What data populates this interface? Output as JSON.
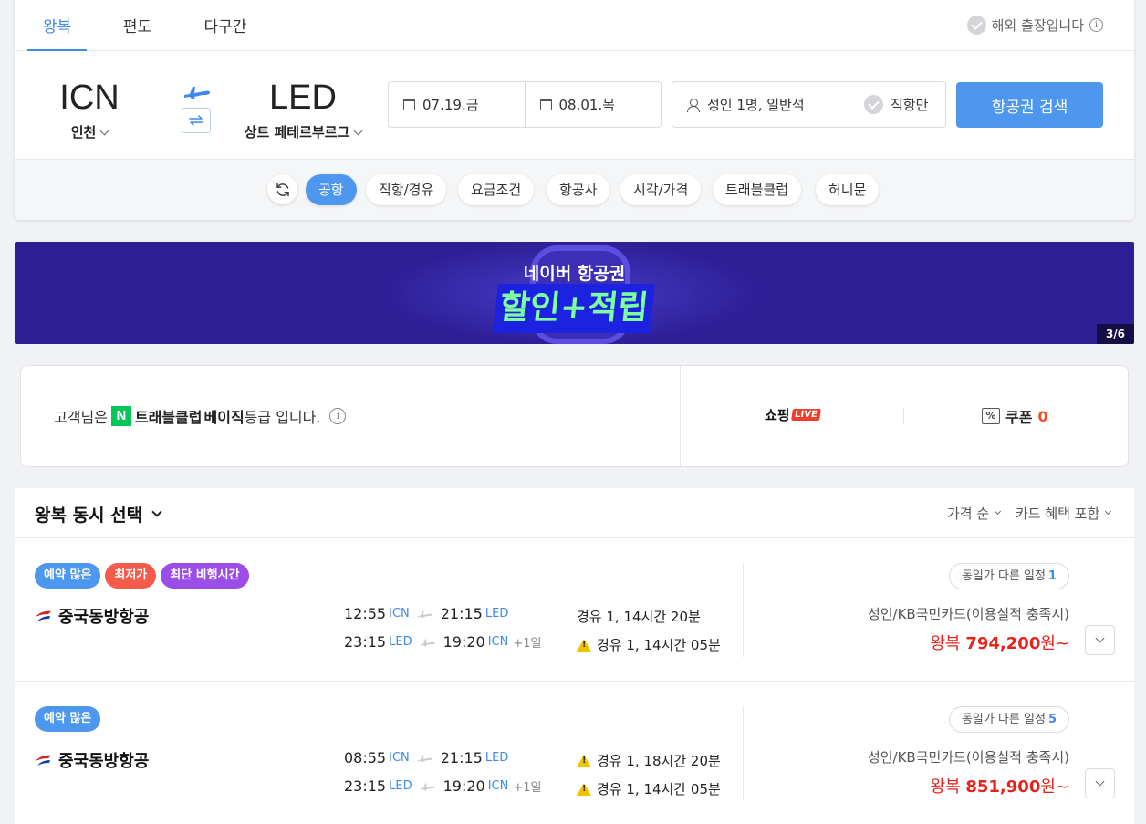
{
  "tabs": [
    {
      "label": "왕복",
      "active": true
    },
    {
      "label": "편도",
      "active": false
    },
    {
      "label": "다구간",
      "active": false
    }
  ],
  "business_trip": {
    "label": "해외 출장입니다",
    "info": "i"
  },
  "route": {
    "origin": {
      "code": "ICN",
      "name": "인천"
    },
    "destination": {
      "code": "LED",
      "name": "상트 페테르부르그"
    }
  },
  "dates": {
    "depart": "07.19.금",
    "return": "08.01.목"
  },
  "passengers": {
    "label": "성인 1명, 일반석"
  },
  "direct_only": {
    "label": "직항만"
  },
  "search_button": {
    "label": "항공권 검색"
  },
  "filters": [
    "공항",
    "직항/경유",
    "요금조건",
    "항공사",
    "시각/가격",
    "트래블클럽",
    "허니문"
  ],
  "active_filter": "공항",
  "banner": {
    "line1": "네이버 항공권",
    "line2": "할인+적립",
    "counter": "3/6"
  },
  "membership": {
    "prefix": "고객님은",
    "n_logo": "N",
    "club": "트래블클럽",
    "grade": "베이직",
    "suffix": "등급 입니다.",
    "shopping": "쇼핑",
    "live": "LIVE",
    "coupon_label": "쿠폰",
    "coupon_icon": "%",
    "coupon_count": "0"
  },
  "results": {
    "title": "왕복 동시 선택",
    "sort": "가격 순",
    "card_filter": "카드 혜택 포함",
    "items": [
      {
        "badges": [
          {
            "label": "예약 많은",
            "color": "#4e97ef"
          },
          {
            "label": "최저가",
            "color": "#f45b4b"
          },
          {
            "label": "최단 비행시간",
            "color": "#9b4de8"
          }
        ],
        "airline": "중국동방항공",
        "outbound": {
          "dep": "12:55",
          "dep_ap": "ICN",
          "arr": "21:15",
          "arr_ap": "LED",
          "plus": "",
          "stop": "경유 1, 14시간 20분",
          "warn": false
        },
        "inbound": {
          "dep": "23:15",
          "dep_ap": "LED",
          "arr": "19:20",
          "arr_ap": "ICN",
          "plus": "+1일",
          "stop": "경유 1, 14시간 05분",
          "warn": true
        },
        "other_schedule": {
          "label": "동일가 다른 일정",
          "count": "1"
        },
        "fare_condition": "성인/KB국민카드(이용실적 충족시)",
        "price_prefix": "왕복",
        "price": "794,200",
        "price_suffix": "원~"
      },
      {
        "badges": [
          {
            "label": "예약 많은",
            "color": "#4e97ef"
          }
        ],
        "airline": "중국동방항공",
        "outbound": {
          "dep": "08:55",
          "dep_ap": "ICN",
          "arr": "21:15",
          "arr_ap": "LED",
          "plus": "",
          "stop": "경유 1, 18시간 20분",
          "warn": true
        },
        "inbound": {
          "dep": "23:15",
          "dep_ap": "LED",
          "arr": "19:20",
          "arr_ap": "ICN",
          "plus": "+1일",
          "stop": "경유 1, 14시간 05분",
          "warn": true
        },
        "other_schedule": {
          "label": "동일가 다른 일정",
          "count": "5"
        },
        "fare_condition": "성인/KB국민카드(이용실적 충족시)",
        "price_prefix": "왕복",
        "price": "851,900",
        "price_suffix": "원~"
      }
    ]
  }
}
